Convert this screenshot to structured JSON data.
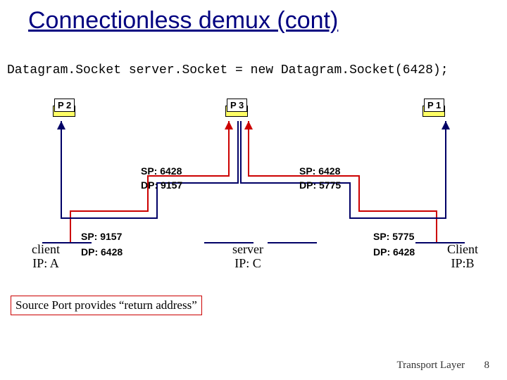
{
  "title": "Connectionless demux (cont)",
  "code_line": "Datagram.Socket server.Socket = new Datagram.Socket(6428);",
  "processes": {
    "p1": "P 1",
    "p2": "P 2",
    "p3": "P 3"
  },
  "labels": {
    "sp6428": "SP: 6428",
    "dp9157": "DP: 9157",
    "dp5775": "DP: 5775",
    "sp9157": "SP: 9157",
    "sp5775": "SP: 5775",
    "dp6428": "DP: 6428"
  },
  "hosts": {
    "clientA_l1": "client",
    "clientA_l2": "IP: A",
    "server_l1": "server",
    "server_l2": "IP: C",
    "clientB_l1": "Client",
    "clientB_l2": "IP:B"
  },
  "note": "Source Port provides “return address”",
  "footer": {
    "left": "Transport Layer",
    "page": "8"
  },
  "chart_data": {
    "type": "diagram",
    "title": "Connectionless demux (cont)",
    "nodes": [
      {
        "id": "P2",
        "label": "P 2",
        "host": "client IP: A"
      },
      {
        "id": "P3",
        "label": "P 3",
        "host": "server IP: C"
      },
      {
        "id": "P1",
        "label": "P 1",
        "host": "Client IP:B"
      }
    ],
    "edges": [
      {
        "from": "P2",
        "to": "P3",
        "sp": 9157,
        "dp": 6428
      },
      {
        "from": "P3",
        "to": "P2",
        "sp": 6428,
        "dp": 9157
      },
      {
        "from": "P1",
        "to": "P3",
        "sp": 5775,
        "dp": 6428
      },
      {
        "from": "P3",
        "to": "P1",
        "sp": 6428,
        "dp": 5775
      }
    ],
    "annotation": "Source Port provides “return address”"
  }
}
